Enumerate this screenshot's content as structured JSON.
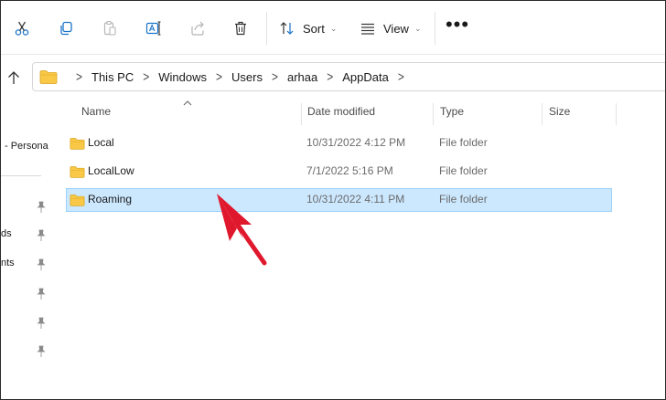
{
  "toolbar": {
    "cut_icon": "scissors-icon",
    "copy_icon": "copy-icon",
    "paste_icon": "clipboard-icon",
    "rename_icon": "rename-icon",
    "share_icon": "share-icon",
    "delete_icon": "trash-icon",
    "sort_label": "Sort",
    "view_label": "View",
    "more_label": "•••"
  },
  "address": {
    "crumbs": [
      "This PC",
      "Windows",
      "Users",
      "arhaa",
      "AppData"
    ]
  },
  "nav": {
    "personal_label": "- Persona",
    "partial_1": "ds",
    "partial_2": "nts"
  },
  "columns": {
    "name": "Name",
    "date": "Date modified",
    "type": "Type",
    "size": "Size"
  },
  "files": [
    {
      "name": "Local",
      "date": "10/31/2022 4:12 PM",
      "type": "File folder",
      "selected": false
    },
    {
      "name": "LocalLow",
      "date": "7/1/2022 5:16 PM",
      "type": "File folder",
      "selected": false
    },
    {
      "name": "Roaming",
      "date": "10/31/2022 4:11 PM",
      "type": "File folder",
      "selected": true
    }
  ],
  "colors": {
    "accent": "#1a73c9",
    "selection_bg": "#cce8ff",
    "selection_border": "#99d1ff",
    "folder_yellow": "#f8c846",
    "annotation_arrow": "#e0182d"
  }
}
